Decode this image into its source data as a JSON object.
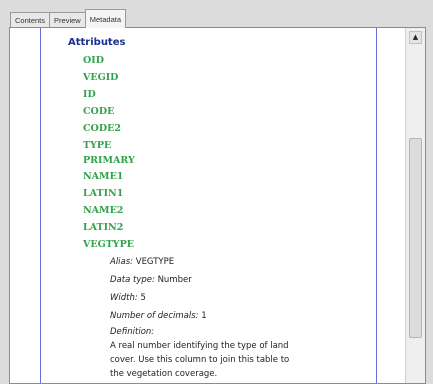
{
  "tabs": [
    {
      "label": "Contents"
    },
    {
      "label": "Preview"
    },
    {
      "label": "Metadata"
    }
  ],
  "heading": "Attributes",
  "attributes": [
    "OID",
    "VEGID",
    "ID",
    "CODE",
    "CODE2",
    "TYPE",
    "PRIMARY",
    "NAME1",
    "LATIN1",
    "NAME2",
    "LATIN2",
    "VEGTYPE"
  ],
  "details": {
    "alias_label": "Alias:",
    "alias_value": "VEGTYPE",
    "data_type_label": "Data type:",
    "data_type_value": "Number",
    "width_label": "Width:",
    "width_value": "5",
    "decimals_label": "Number of decimals:",
    "decimals_value": "1",
    "definition_label": "Definition:",
    "definition_lines": [
      "A real number identifying the type of land",
      "cover. Use this column to join this table to",
      "the vegetation coverage."
    ]
  },
  "scrollbar": {
    "up_arrow_icon": "triangle-up-icon"
  },
  "colors": {
    "heading": "#1a2e8f",
    "attribute": "#2fa24a",
    "guide_line": "#6b6bd6"
  }
}
